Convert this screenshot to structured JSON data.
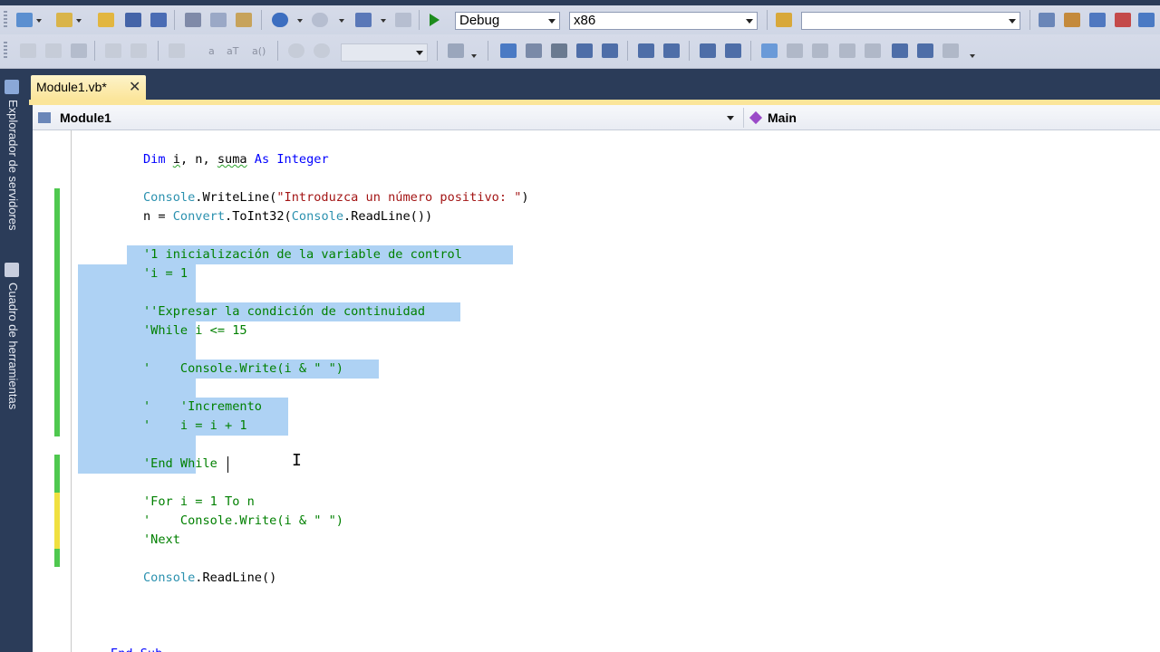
{
  "toolbar": {
    "config_dropdown": "Debug",
    "platform_dropdown": "x86",
    "find_box": "",
    "format_labels": [
      "a",
      "aT",
      "a()"
    ]
  },
  "sidebar": {
    "server_explorer": "Explorador de servidores",
    "toolbox": "Cuadro de herramientas"
  },
  "tab": {
    "title": "Module1.vb*",
    "close": "✕"
  },
  "navbar": {
    "left": "Module1",
    "right": "Main"
  },
  "code": {
    "l1": {
      "kw1": "Dim",
      "i": "i",
      "sep1": ", n, ",
      "suma": "suma",
      "sp": " ",
      "kw2": "As",
      "sp2": " ",
      "kw3": "Integer"
    },
    "l3": {
      "obj": "Console",
      "method": ".WriteLine(",
      "str": "\"Introduzca un número positivo: \"",
      "end": ")"
    },
    "l4": {
      "pre": "n = ",
      "cls": "Convert",
      "mid": ".ToInt32(",
      "cls2": "Console",
      "end": ".ReadLine())"
    },
    "c1": "'1 inicialización de la variable de control",
    "c2": "'i = 1",
    "c3": "''Expresar la condición de continuidad",
    "c4": "'While i <= 15",
    "c5": "'    Console.Write(i & \" \")",
    "c6": "'    'Incremento",
    "c7": "'    i = i + 1",
    "c8": "'End While",
    "c9": "'For i = 1 To n",
    "c10": "'    Console.Write(i & \" \")",
    "c11": "'Next",
    "l_last": {
      "obj": "Console",
      "end": ".ReadLine()"
    },
    "endsub": "End Sub"
  },
  "colors": {
    "keyword": "#0000ff",
    "type": "#2b91af",
    "string": "#a31515",
    "comment": "#008000",
    "selection": "#aed2f4",
    "saved_change": "#4fc84f",
    "unsaved_change": "#f0e040"
  }
}
